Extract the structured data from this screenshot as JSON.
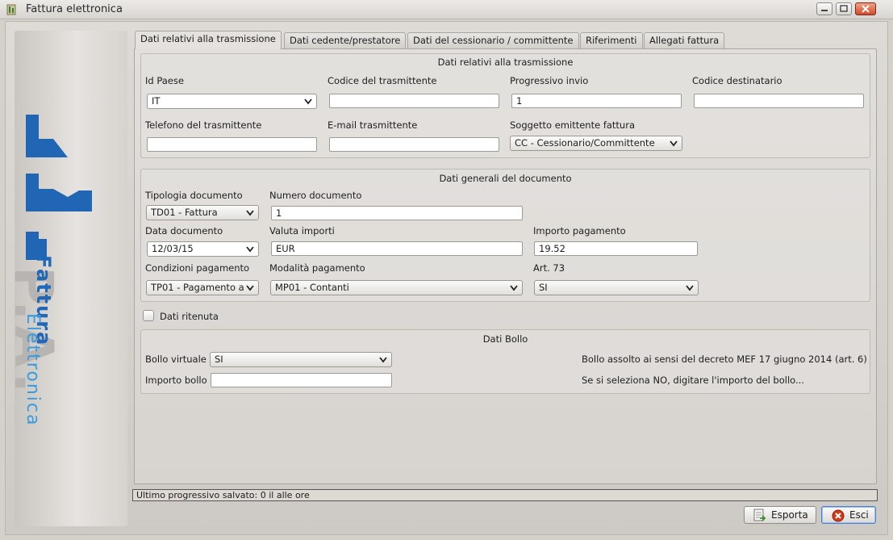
{
  "window": {
    "title": "Fattura elettronica"
  },
  "logo": {
    "line1": "P.A.",
    "line2": "Fattura",
    "line3": "Elettronica"
  },
  "tabs": [
    {
      "label": "Dati relativi alla trasmissione"
    },
    {
      "label": "Dati cedente/prestatore"
    },
    {
      "label": "Dati del cessionario / committente"
    },
    {
      "label": "Riferimenti"
    },
    {
      "label": "Allegati fattura"
    }
  ],
  "trasmissione": {
    "title": "Dati relativi alla trasmissione",
    "id_paese_label": "Id Paese",
    "id_paese_value": "IT",
    "codice_trasmittente_label": "Codice del trasmittente",
    "codice_trasmittente_value": "",
    "progressivo_label": "Progressivo invio",
    "progressivo_value": "1",
    "codice_destinatario_label": "Codice destinatario",
    "codice_destinatario_value": "",
    "telefono_label": "Telefono del trasmittente",
    "telefono_value": "",
    "email_label": "E-mail trasmittente",
    "email_value": "",
    "soggetto_label": "Soggetto emittente fattura",
    "soggetto_value": "CC - Cessionario/Committente"
  },
  "generali": {
    "title": "Dati generali del documento",
    "tipologia_label": "Tipologia documento",
    "tipologia_value": "TD01 - Fattura",
    "numero_label": "Numero documento",
    "numero_value": "1",
    "data_label": "Data documento",
    "data_value": "12/03/15",
    "valuta_label": "Valuta importi",
    "valuta_value": "EUR",
    "importo_pag_label": "Importo pagamento",
    "importo_pag_value": "19.52",
    "condizioni_label": "Condizioni pagamento",
    "condizioni_value": "TP01 - Pagamento a",
    "modalita_label": "Modalità pagamento",
    "modalita_value": "MP01 - Contanti",
    "art73_label": "Art. 73",
    "art73_value": "SI"
  },
  "ritenuta": {
    "label": "Dati ritenuta"
  },
  "bollo": {
    "title": "Dati Bollo",
    "virtuale_label": "Bollo virtuale",
    "virtuale_value": "SI",
    "importo_label": "Importo bollo",
    "importo_value": "",
    "note1": "Bollo assolto ai sensi del decreto MEF 17 giugno 2014 (art. 6)",
    "note2": "Se si seleziona NO, digitare l'importo del bollo..."
  },
  "status": {
    "text": "Ultimo progressivo salvato: 0 il  alle ore"
  },
  "buttons": {
    "esporta": "Esporta",
    "esci": "Esci"
  },
  "colors": {
    "logo_blue": "#1f67b8",
    "logo_light_blue": "#3a9be0",
    "close_red": "#d23a1d"
  }
}
